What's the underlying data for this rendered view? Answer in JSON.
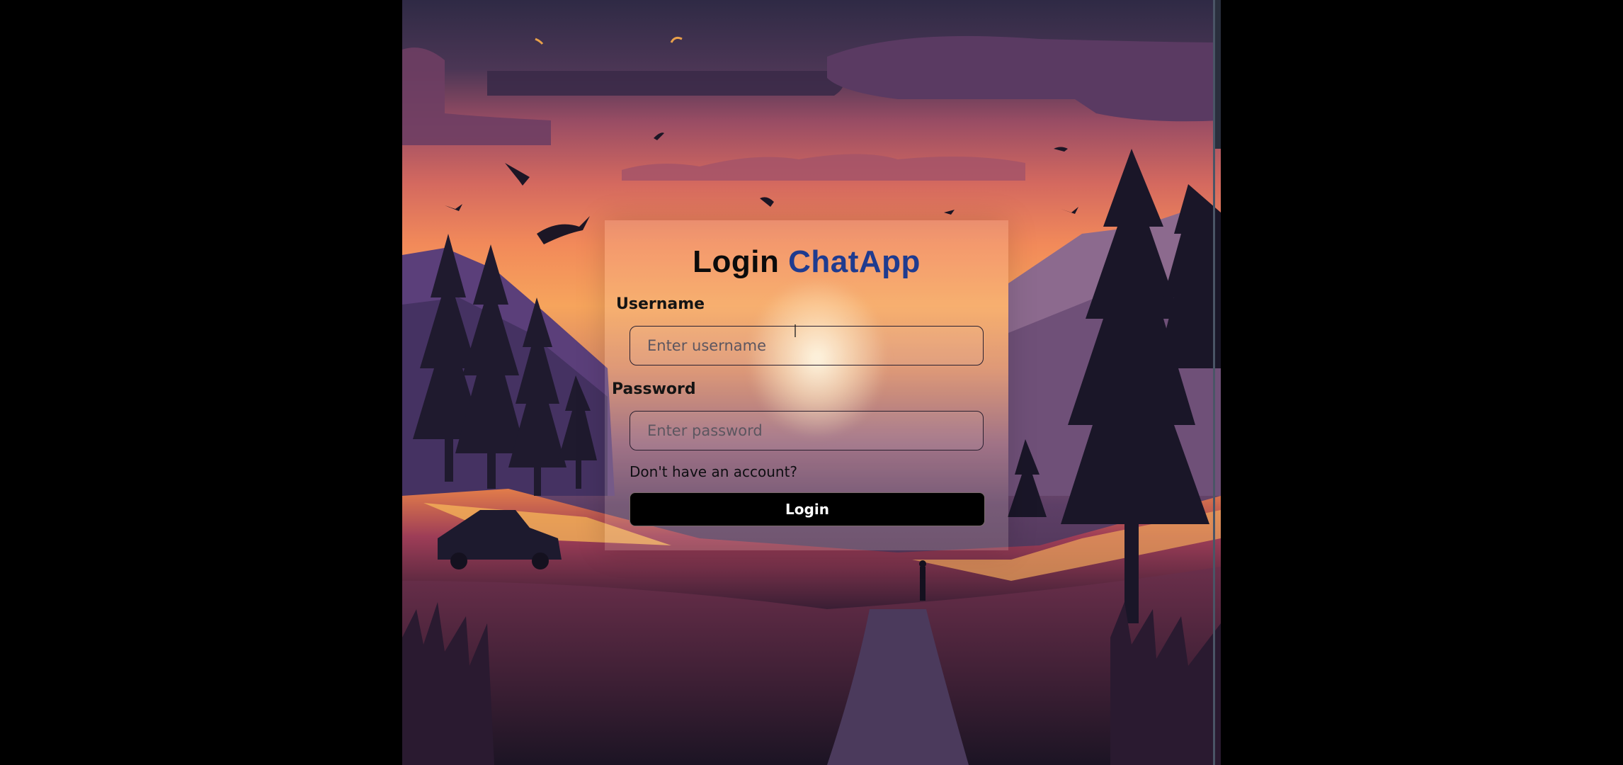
{
  "login": {
    "title_prefix": "Login",
    "title_brand": "ChatApp",
    "username_label": "Username",
    "username_placeholder": "Enter username",
    "password_label": "Password",
    "password_placeholder": "Enter password",
    "signup_link": "Don't have an account?",
    "login_button": "Login"
  },
  "colors": {
    "brand": "#1f3b8f",
    "button_bg": "#000000",
    "button_text": "#ffffff"
  }
}
